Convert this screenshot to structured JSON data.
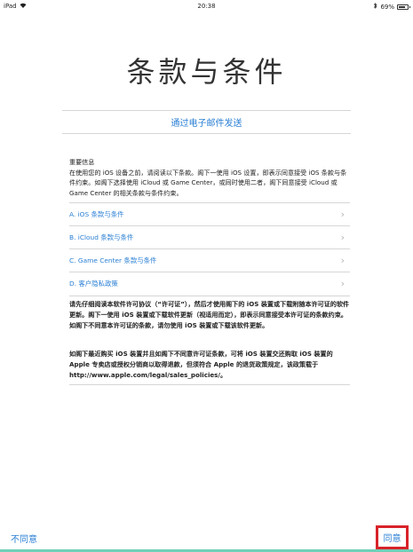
{
  "status_bar": {
    "device": "iPad",
    "wifi_icon": "wifi-icon",
    "time": "20:38",
    "bluetooth_icon": "bluetooth-icon",
    "battery": "69%"
  },
  "title": "条款与条件",
  "email_link": "通过电子邮件发送",
  "important": {
    "heading": "重要信息",
    "body": "在使用您的 iOS 设备之前，请阅读以下条款。阁下一使用 iOS 设置，即表示同意接受 iOS 条款与条件约束。如阁下选择使用 iCloud 或 Game Center，或同时使用二者，阁下同意接受 iCloud 或 Game Center 的相关条款与条件约束。"
  },
  "links": [
    {
      "label": "A. iOS 条款与条件"
    },
    {
      "label": "B. iCloud 条款与条件"
    },
    {
      "label": "C. Game Center 条款与条件"
    },
    {
      "label": "D. 客户隐私政策"
    }
  ],
  "paragraphs": [
    "请先仔细阅读本软件许可协议（“许可证”），然后才使用阁下的 iOS 装置或下载附随本许可证的软件更新。阁下一使用 iOS 装置或下载软件更新（视适用而定），即表示同意接受本许可证的条款约束。如阁下不同意本许可证的条款，请勿使用 iOS 装置或下载该软件更新。",
    "如阁下最近购买 iOS 装置并且如阁下不同意许可证条款，可将 iOS 装置交还购取 iOS 装置的 Apple 专卖店或授权分销商以取得退款，但须符合 Apple 的退货政策规定，该政策载于 http://www.apple.com/legal/sales_policies/。"
  ],
  "footer": {
    "disagree": "不同意",
    "agree": "同意"
  },
  "colors": {
    "accent": "#2a7fd4",
    "highlight": "#d8232a"
  }
}
